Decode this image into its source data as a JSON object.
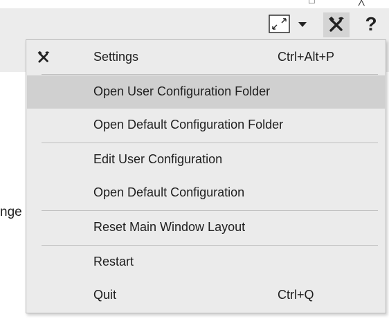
{
  "window": {
    "maximize_glyph": "□",
    "close_glyph": "╳"
  },
  "toolbar": {
    "fullscreen_icon": "expand-arrows-icon",
    "dropdown_icon": "caret-down-icon",
    "tools_icon": "tools-icon",
    "help_label": "?"
  },
  "content": {
    "partial_text": "nge"
  },
  "menu": {
    "items": [
      {
        "label": "Settings",
        "shortcut": "Ctrl+Alt+P",
        "icon": "tools-icon"
      },
      {
        "label": "Open User Configuration Folder",
        "shortcut": ""
      },
      {
        "label": "Open Default Configuration Folder",
        "shortcut": ""
      },
      {
        "label": "Edit User Configuration",
        "shortcut": ""
      },
      {
        "label": "Open Default Configuration",
        "shortcut": ""
      },
      {
        "label": "Reset Main Window Layout",
        "shortcut": ""
      },
      {
        "label": "Restart",
        "shortcut": ""
      },
      {
        "label": "Quit",
        "shortcut": "Ctrl+Q"
      }
    ]
  },
  "colors": {
    "highlight": "#d0d0d0",
    "menu_bg": "#ebebeb",
    "toolbar_bg": "#ececec",
    "active_button_bg": "#d4d4d4"
  }
}
